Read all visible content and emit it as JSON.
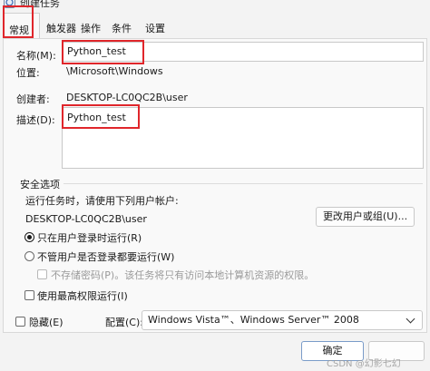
{
  "window": {
    "title": "创建任务",
    "accent": "#e0262b"
  },
  "tabs": [
    {
      "label": "常规",
      "active": true
    },
    {
      "label": "触发器"
    },
    {
      "label": "操作"
    },
    {
      "label": "条件"
    },
    {
      "label": "设置"
    }
  ],
  "general": {
    "name_label": "名称(M):",
    "name_value": "Python_test",
    "location_label": "位置:",
    "location_value": "\\Microsoft\\Windows",
    "author_label": "创建者:",
    "author_value": "DESKTOP-LC0QC2B\\user",
    "description_label": "描述(D):",
    "description_value": "Python_test"
  },
  "security": {
    "group_title": "安全选项",
    "run_as_label": "运行任务时，请使用下列用户帐户:",
    "run_as_value": "DESKTOP-LC0QC2B\\user",
    "change_user_button": "更改用户或组(U)...",
    "radio_logged_on": "只在用户登录时运行(R)",
    "radio_logged_on_checked": true,
    "radio_whether_logged": "不管用户是否登录都要运行(W)",
    "no_store_password": "不存储密码(P)。该任务将只有访问本地计算机资源的权限。",
    "highest_privileges": "使用最高权限运行(I)"
  },
  "bottom": {
    "hidden_label": "隐藏(E)",
    "configure_label": "配置(C):",
    "configure_value": "Windows Vista™、Windows Server™ 2008",
    "ok_button": "确定"
  },
  "watermark": "CSDN @幻影七幻"
}
